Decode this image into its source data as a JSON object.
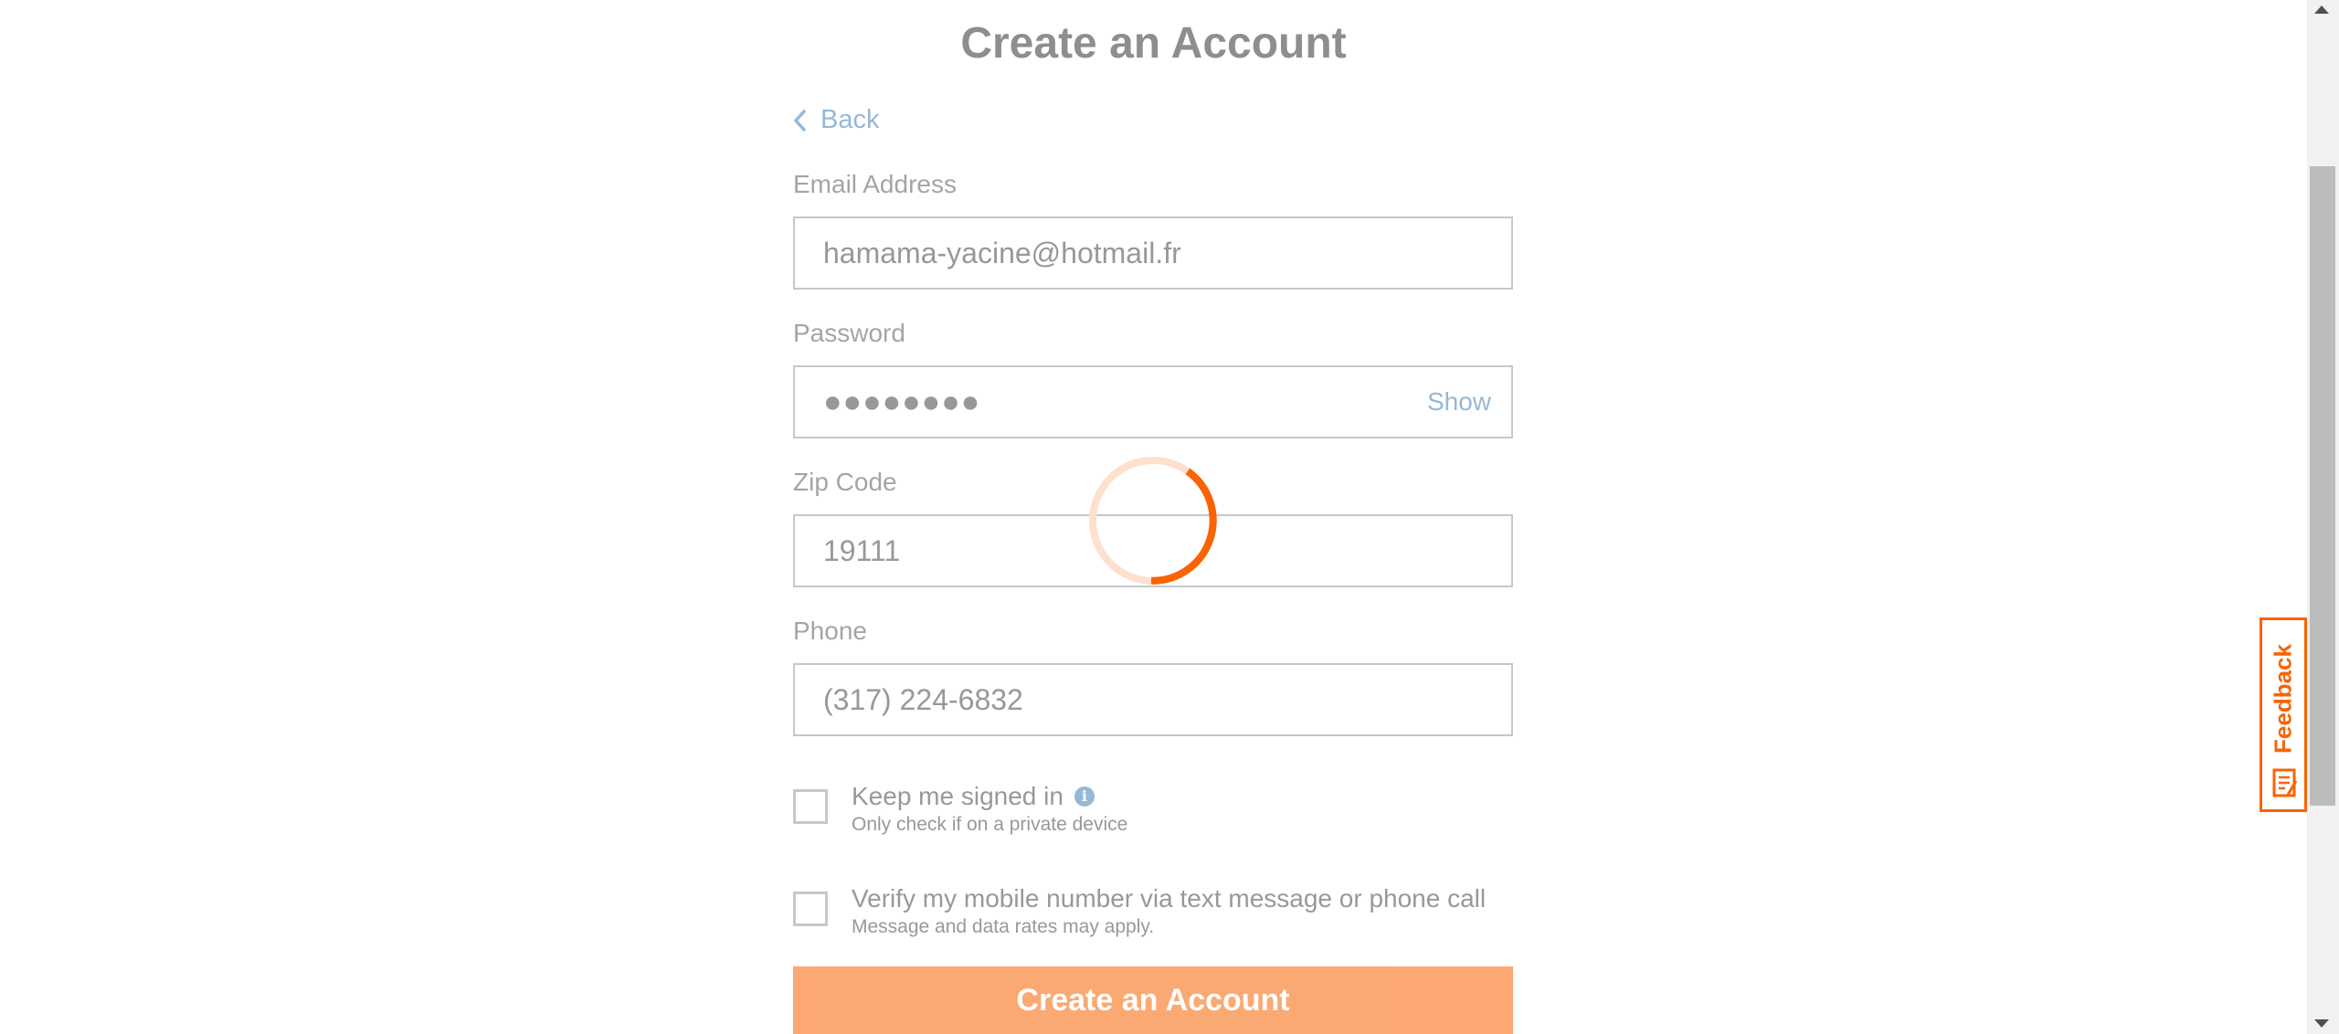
{
  "header": {
    "title": "Create an Account",
    "back_label": "Back"
  },
  "form": {
    "email": {
      "label": "Email Address",
      "value": "hamama-yacine@hotmail.fr"
    },
    "password": {
      "label": "Password",
      "value_masked": "●●●●●●●●",
      "show_label": "Show"
    },
    "zip": {
      "label": "Zip Code",
      "value": "19111"
    },
    "phone": {
      "label": "Phone",
      "value": "(317) 224-6832"
    },
    "keep_signed_in": {
      "label": "Keep me signed in",
      "sub": "Only check if on a private device",
      "checked": false,
      "info_icon": "info-icon"
    },
    "verify_mobile": {
      "label": "Verify my mobile number via text message or phone call",
      "sub": "Message and data rates may apply.",
      "checked": false
    },
    "submit_label": "Create an Account"
  },
  "feedback": {
    "label": "Feedback",
    "icon": "feedback-form-icon"
  },
  "loading": {
    "icon": "loading-spinner",
    "color": "#f96302"
  },
  "colors": {
    "accent": "#f96302",
    "link": "#3f7fb5",
    "text": "#333333"
  }
}
